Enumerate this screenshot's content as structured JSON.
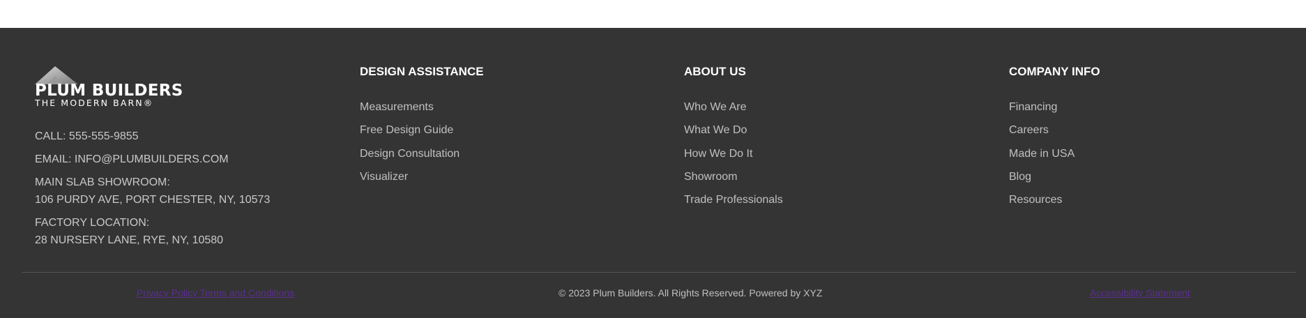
{
  "brand": {
    "name": "PLUM BUILDERS",
    "tagline": "THE MODERN BARN®"
  },
  "contact": {
    "call": "CALL: 555-555-9855",
    "email": "EMAIL: INFO@PLUMBUILDERS.COM",
    "showroom_label": "MAIN SLAB SHOWROOM:",
    "showroom_address": "106 PURDY AVE, PORT CHESTER, NY, 10573",
    "factory_label": "FACTORY LOCATION:",
    "factory_address": "28 NURSERY LANE, RYE, NY, 10580"
  },
  "columns": [
    {
      "heading": "DESIGN ASSISTANCE",
      "links": [
        "Measurements",
        "Free Design Guide",
        "Design Consultation",
        "Visualizer"
      ]
    },
    {
      "heading": "ABOUT US",
      "links": [
        "Who We Are",
        "What We Do",
        "How We Do It",
        "Showroom",
        "Trade Professionals"
      ]
    },
    {
      "heading": "COMPANY INFO",
      "links": [
        "Financing",
        "Careers",
        "Made in USA",
        "Blog",
        "Resources"
      ]
    }
  ],
  "bottom": {
    "legal_links": "Privacy Policy Terms and Conditions",
    "copyright": "© 2023 Plum Builders. All Rights Reserved. Powered by XYZ",
    "accessibility": "Accessibility Statement"
  },
  "colors": {
    "footer_bg": "#343434",
    "heading": "#ffffff",
    "link": "#c0c0c0",
    "legal_link": "#5a2e91"
  }
}
